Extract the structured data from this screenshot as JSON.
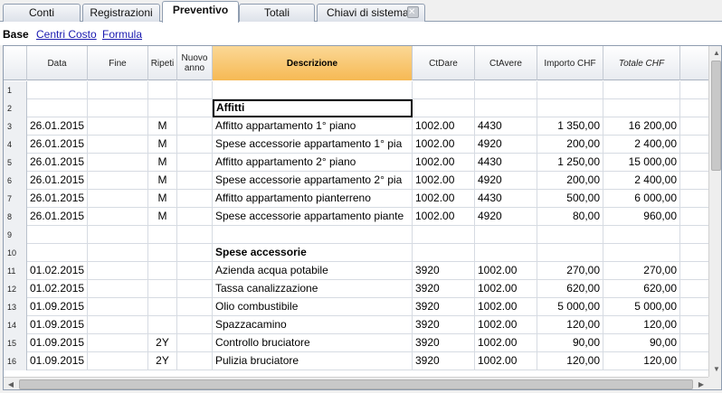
{
  "tabs": [
    {
      "label": "Conti"
    },
    {
      "label": "Registrazioni"
    },
    {
      "label": "Preventivo",
      "active": true
    },
    {
      "label": "Totali"
    },
    {
      "label": "Chiavi di sistema",
      "close_icon": "close-icon"
    }
  ],
  "views": {
    "active": "Base",
    "links": [
      "Centri Costo",
      "Formula"
    ]
  },
  "columns": [
    "",
    "Data",
    "Fine",
    "Ripeti",
    "Nuovo anno",
    "Descrizione",
    "CtDare",
    "CtAvere",
    "Importo CHF",
    "Totale CHF"
  ],
  "rows": [
    {
      "n": "1",
      "data": "",
      "fine": "",
      "ripeti": "",
      "nuovo": "",
      "descr": "",
      "dare": "",
      "avere": "",
      "importo": "",
      "totale": ""
    },
    {
      "n": "2",
      "data": "",
      "fine": "",
      "ripeti": "",
      "nuovo": "",
      "descr": "Affitti",
      "dare": "",
      "avere": "",
      "importo": "",
      "totale": "",
      "bold": true,
      "focus": true
    },
    {
      "n": "3",
      "data": "26.01.2015",
      "fine": "",
      "ripeti": "M",
      "nuovo": "",
      "descr": "Affitto appartamento 1° piano",
      "dare": "1002.00",
      "avere": "4430",
      "importo": "1 350,00",
      "totale": "16 200,00"
    },
    {
      "n": "4",
      "data": "26.01.2015",
      "fine": "",
      "ripeti": "M",
      "nuovo": "",
      "descr": "Spese accessorie appartamento 1° pia",
      "dare": "1002.00",
      "avere": "4920",
      "importo": "200,00",
      "totale": "2 400,00"
    },
    {
      "n": "5",
      "data": "26.01.2015",
      "fine": "",
      "ripeti": "M",
      "nuovo": "",
      "descr": "Affitto appartamento 2° piano",
      "dare": "1002.00",
      "avere": "4430",
      "importo": "1 250,00",
      "totale": "15 000,00"
    },
    {
      "n": "6",
      "data": "26.01.2015",
      "fine": "",
      "ripeti": "M",
      "nuovo": "",
      "descr": "Spese accessorie appartamento 2° pia",
      "dare": "1002.00",
      "avere": "4920",
      "importo": "200,00",
      "totale": "2 400,00"
    },
    {
      "n": "7",
      "data": "26.01.2015",
      "fine": "",
      "ripeti": "M",
      "nuovo": "",
      "descr": "Affitto appartamento pianterreno",
      "dare": "1002.00",
      "avere": "4430",
      "importo": "500,00",
      "totale": "6 000,00"
    },
    {
      "n": "8",
      "data": "26.01.2015",
      "fine": "",
      "ripeti": "M",
      "nuovo": "",
      "descr": "Spese accessorie appartamento piante",
      "dare": "1002.00",
      "avere": "4920",
      "importo": "80,00",
      "totale": "960,00"
    },
    {
      "n": "9",
      "data": "",
      "fine": "",
      "ripeti": "",
      "nuovo": "",
      "descr": "",
      "dare": "",
      "avere": "",
      "importo": "",
      "totale": ""
    },
    {
      "n": "10",
      "data": "",
      "fine": "",
      "ripeti": "",
      "nuovo": "",
      "descr": "Spese accessorie",
      "dare": "",
      "avere": "",
      "importo": "",
      "totale": "",
      "bold": true
    },
    {
      "n": "11",
      "data": "01.02.2015",
      "fine": "",
      "ripeti": "",
      "nuovo": "",
      "descr": "Azienda acqua potabile",
      "dare": "3920",
      "avere": "1002.00",
      "importo": "270,00",
      "totale": "270,00"
    },
    {
      "n": "12",
      "data": "01.02.2015",
      "fine": "",
      "ripeti": "",
      "nuovo": "",
      "descr": "Tassa canalizzazione",
      "dare": "3920",
      "avere": "1002.00",
      "importo": "620,00",
      "totale": "620,00"
    },
    {
      "n": "13",
      "data": "01.09.2015",
      "fine": "",
      "ripeti": "",
      "nuovo": "",
      "descr": "Olio combustibile",
      "dare": "3920",
      "avere": "1002.00",
      "importo": "5 000,00",
      "totale": "5 000,00"
    },
    {
      "n": "14",
      "data": "01.09.2015",
      "fine": "",
      "ripeti": "",
      "nuovo": "",
      "descr": "Spazzacamino",
      "dare": "3920",
      "avere": "1002.00",
      "importo": "120,00",
      "totale": "120,00"
    },
    {
      "n": "15",
      "data": "01.09.2015",
      "fine": "",
      "ripeti": "2Y",
      "nuovo": "",
      "descr": "Controllo bruciatore",
      "dare": "3920",
      "avere": "1002.00",
      "importo": "90,00",
      "totale": "90,00"
    },
    {
      "n": "16",
      "data": "01.09.2015",
      "fine": "",
      "ripeti": "2Y",
      "nuovo": "",
      "descr": "Pulizia bruciatore",
      "dare": "3920",
      "avere": "1002.00",
      "importo": "120,00",
      "totale": "120,00"
    }
  ],
  "icons": {
    "scroll_up": "scroll-up-icon",
    "scroll_down": "scroll-down-icon",
    "scroll_left": "scroll-left-icon",
    "scroll_right": "scroll-right-icon"
  },
  "colors": {
    "selected_header": "#f6b954",
    "link": "#1a1ab0",
    "grid_border": "#8f9db0"
  }
}
